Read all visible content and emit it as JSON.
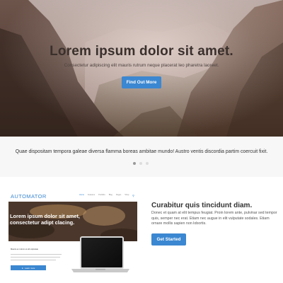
{
  "hero": {
    "title": "Lorem ipsum dolor sit amet.",
    "subtitle": "Consectetur adipiscing elit mauris rutrum neque placerat leo pharetra laoreet.",
    "button_label": "Find Out More"
  },
  "testimonial": {
    "text": "Quae dispositam tempora galeae diversa flamma boreas ambitae mundo! Austro ventis discordia partim coercuit fixit.",
    "slides": 3,
    "active_slide": 1
  },
  "feature": {
    "title": "Curabitur quis tincidunt diam.",
    "text": "Donec et quam at elit tempus feugiat. Proin lorem ante, pulvinar sed tempor quis, semper nec erat. Etiam nec augue in elit vulputate sodales. Etiam ornare mollis sapien non lobortis.",
    "button_label": "Get Started",
    "preview": {
      "logo": "AUTOMATOR",
      "nav_links": [
        "Home",
        "Features",
        "Portfolio",
        "Blog",
        "Pages",
        "Shop"
      ],
      "active_link": "Home",
      "hero_title_lines": [
        "Lorem ipsum dolor sit amet,",
        "consectetur adipt clacing."
      ],
      "lower_heading": "Mauris ex rutrum et elit vulputate",
      "button_label": "Learn more"
    }
  },
  "colors": {
    "accent": "#3b87d1",
    "strip_bg": "#f7f7f7",
    "text_dark": "#333333"
  }
}
